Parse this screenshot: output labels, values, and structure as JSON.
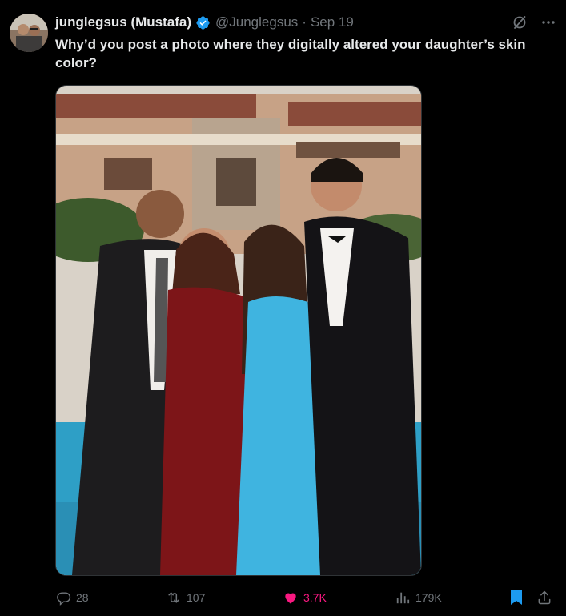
{
  "tweet": {
    "display_name": "junglegsus (Mustafa)",
    "handle": "@Junglegsus",
    "separator": "·",
    "timestamp": "Sep 19",
    "verified": true,
    "text": "Why’d you post a photo where they digitally altered your daughter’s skin color?"
  },
  "stats": {
    "replies": "28",
    "reposts": "107",
    "likes": "3.7K",
    "views": "179K"
  },
  "state": {
    "liked": true,
    "bookmarked": true
  },
  "colors": {
    "background": "#000000",
    "text": "#e7e9ea",
    "muted": "#71767b",
    "verified": "#1d9bf0",
    "like": "#f91880",
    "bookmark": "#1d9bf0"
  },
  "icons": [
    "grok-icon",
    "more-icon",
    "verified-badge-icon",
    "reply-icon",
    "retweet-icon",
    "heart-icon",
    "views-icon",
    "bookmark-icon",
    "share-icon"
  ]
}
